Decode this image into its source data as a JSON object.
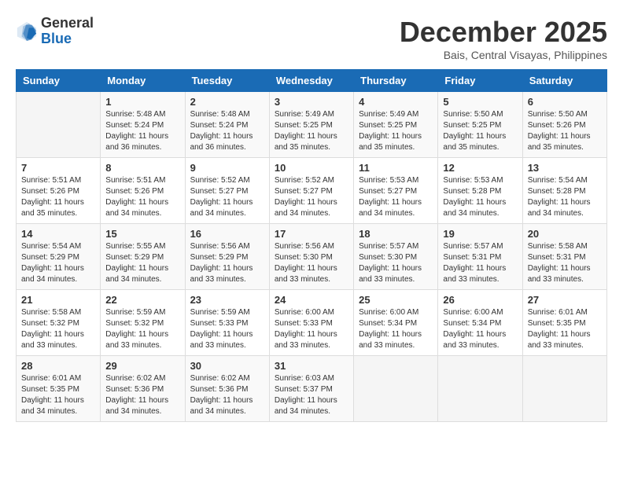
{
  "header": {
    "logo_line1": "General",
    "logo_line2": "Blue",
    "month_title": "December 2025",
    "location": "Bais, Central Visayas, Philippines"
  },
  "weekdays": [
    "Sunday",
    "Monday",
    "Tuesday",
    "Wednesday",
    "Thursday",
    "Friday",
    "Saturday"
  ],
  "weeks": [
    [
      {
        "day": "",
        "info": ""
      },
      {
        "day": "1",
        "info": "Sunrise: 5:48 AM\nSunset: 5:24 PM\nDaylight: 11 hours\nand 36 minutes."
      },
      {
        "day": "2",
        "info": "Sunrise: 5:48 AM\nSunset: 5:24 PM\nDaylight: 11 hours\nand 36 minutes."
      },
      {
        "day": "3",
        "info": "Sunrise: 5:49 AM\nSunset: 5:25 PM\nDaylight: 11 hours\nand 35 minutes."
      },
      {
        "day": "4",
        "info": "Sunrise: 5:49 AM\nSunset: 5:25 PM\nDaylight: 11 hours\nand 35 minutes."
      },
      {
        "day": "5",
        "info": "Sunrise: 5:50 AM\nSunset: 5:25 PM\nDaylight: 11 hours\nand 35 minutes."
      },
      {
        "day": "6",
        "info": "Sunrise: 5:50 AM\nSunset: 5:26 PM\nDaylight: 11 hours\nand 35 minutes."
      }
    ],
    [
      {
        "day": "7",
        "info": "Sunrise: 5:51 AM\nSunset: 5:26 PM\nDaylight: 11 hours\nand 35 minutes."
      },
      {
        "day": "8",
        "info": "Sunrise: 5:51 AM\nSunset: 5:26 PM\nDaylight: 11 hours\nand 34 minutes."
      },
      {
        "day": "9",
        "info": "Sunrise: 5:52 AM\nSunset: 5:27 PM\nDaylight: 11 hours\nand 34 minutes."
      },
      {
        "day": "10",
        "info": "Sunrise: 5:52 AM\nSunset: 5:27 PM\nDaylight: 11 hours\nand 34 minutes."
      },
      {
        "day": "11",
        "info": "Sunrise: 5:53 AM\nSunset: 5:27 PM\nDaylight: 11 hours\nand 34 minutes."
      },
      {
        "day": "12",
        "info": "Sunrise: 5:53 AM\nSunset: 5:28 PM\nDaylight: 11 hours\nand 34 minutes."
      },
      {
        "day": "13",
        "info": "Sunrise: 5:54 AM\nSunset: 5:28 PM\nDaylight: 11 hours\nand 34 minutes."
      }
    ],
    [
      {
        "day": "14",
        "info": "Sunrise: 5:54 AM\nSunset: 5:29 PM\nDaylight: 11 hours\nand 34 minutes."
      },
      {
        "day": "15",
        "info": "Sunrise: 5:55 AM\nSunset: 5:29 PM\nDaylight: 11 hours\nand 34 minutes."
      },
      {
        "day": "16",
        "info": "Sunrise: 5:56 AM\nSunset: 5:29 PM\nDaylight: 11 hours\nand 33 minutes."
      },
      {
        "day": "17",
        "info": "Sunrise: 5:56 AM\nSunset: 5:30 PM\nDaylight: 11 hours\nand 33 minutes."
      },
      {
        "day": "18",
        "info": "Sunrise: 5:57 AM\nSunset: 5:30 PM\nDaylight: 11 hours\nand 33 minutes."
      },
      {
        "day": "19",
        "info": "Sunrise: 5:57 AM\nSunset: 5:31 PM\nDaylight: 11 hours\nand 33 minutes."
      },
      {
        "day": "20",
        "info": "Sunrise: 5:58 AM\nSunset: 5:31 PM\nDaylight: 11 hours\nand 33 minutes."
      }
    ],
    [
      {
        "day": "21",
        "info": "Sunrise: 5:58 AM\nSunset: 5:32 PM\nDaylight: 11 hours\nand 33 minutes."
      },
      {
        "day": "22",
        "info": "Sunrise: 5:59 AM\nSunset: 5:32 PM\nDaylight: 11 hours\nand 33 minutes."
      },
      {
        "day": "23",
        "info": "Sunrise: 5:59 AM\nSunset: 5:33 PM\nDaylight: 11 hours\nand 33 minutes."
      },
      {
        "day": "24",
        "info": "Sunrise: 6:00 AM\nSunset: 5:33 PM\nDaylight: 11 hours\nand 33 minutes."
      },
      {
        "day": "25",
        "info": "Sunrise: 6:00 AM\nSunset: 5:34 PM\nDaylight: 11 hours\nand 33 minutes."
      },
      {
        "day": "26",
        "info": "Sunrise: 6:00 AM\nSunset: 5:34 PM\nDaylight: 11 hours\nand 33 minutes."
      },
      {
        "day": "27",
        "info": "Sunrise: 6:01 AM\nSunset: 5:35 PM\nDaylight: 11 hours\nand 33 minutes."
      }
    ],
    [
      {
        "day": "28",
        "info": "Sunrise: 6:01 AM\nSunset: 5:35 PM\nDaylight: 11 hours\nand 34 minutes."
      },
      {
        "day": "29",
        "info": "Sunrise: 6:02 AM\nSunset: 5:36 PM\nDaylight: 11 hours\nand 34 minutes."
      },
      {
        "day": "30",
        "info": "Sunrise: 6:02 AM\nSunset: 5:36 PM\nDaylight: 11 hours\nand 34 minutes."
      },
      {
        "day": "31",
        "info": "Sunrise: 6:03 AM\nSunset: 5:37 PM\nDaylight: 11 hours\nand 34 minutes."
      },
      {
        "day": "",
        "info": ""
      },
      {
        "day": "",
        "info": ""
      },
      {
        "day": "",
        "info": ""
      }
    ]
  ]
}
